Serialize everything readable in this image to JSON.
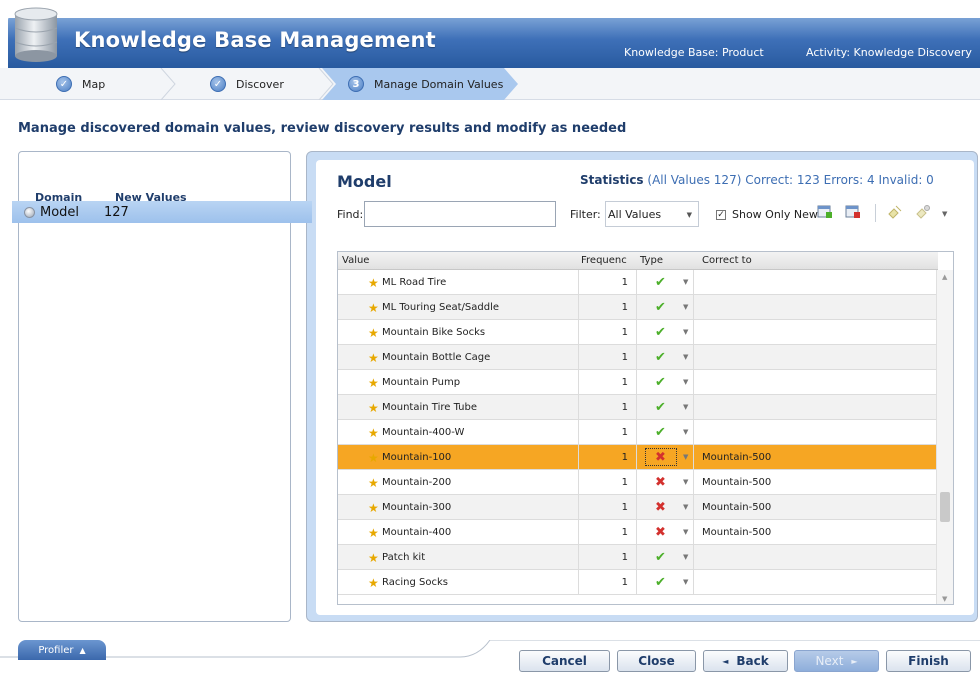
{
  "header": {
    "app_title": "Knowledge Base Management",
    "knowledge_base": "Knowledge Base: Product",
    "activity": "Activity: Knowledge Discovery"
  },
  "steps": [
    {
      "label": "Map",
      "badge": "✓"
    },
    {
      "label": "Discover",
      "badge": "✓"
    },
    {
      "label": "Manage Domain Values",
      "badge": "3"
    }
  ],
  "instruction": "Manage discovered domain values, review discovery results and modify as needed",
  "left_panel": {
    "col_domain": "Domain",
    "col_new_values": "New Values",
    "rows": [
      {
        "domain": "Model",
        "new_values": "127"
      }
    ]
  },
  "right_panel": {
    "title": "Model",
    "stats_label": "Statistics",
    "stats_all": "(All Values 127)",
    "stats_correct": "Correct: 123",
    "stats_errors": "Errors: 4",
    "stats_invalid": "Invalid: 0",
    "find_label": "Find:",
    "find_value": "",
    "filter_label": "Filter:",
    "filter_value": "All Values",
    "show_only_new": "Show Only New"
  },
  "grid": {
    "columns": {
      "value": "Value",
      "frequency": "Frequenc",
      "type": "Type",
      "correct_to": "Correct to"
    },
    "rows": [
      {
        "value": "ML Road Tire",
        "frequency": "1",
        "type": "correct",
        "correct_to": ""
      },
      {
        "value": "ML Touring Seat/Saddle",
        "frequency": "1",
        "type": "correct",
        "correct_to": ""
      },
      {
        "value": "Mountain Bike Socks",
        "frequency": "1",
        "type": "correct",
        "correct_to": ""
      },
      {
        "value": "Mountain Bottle Cage",
        "frequency": "1",
        "type": "correct",
        "correct_to": ""
      },
      {
        "value": "Mountain Pump",
        "frequency": "1",
        "type": "correct",
        "correct_to": ""
      },
      {
        "value": "Mountain Tire Tube",
        "frequency": "1",
        "type": "correct",
        "correct_to": ""
      },
      {
        "value": "Mountain-400-W",
        "frequency": "1",
        "type": "correct",
        "correct_to": ""
      },
      {
        "value": "Mountain-100",
        "frequency": "1",
        "type": "error",
        "correct_to": "Mountain-500",
        "selected": true
      },
      {
        "value": "Mountain-200",
        "frequency": "1",
        "type": "error",
        "correct_to": "Mountain-500"
      },
      {
        "value": "Mountain-300",
        "frequency": "1",
        "type": "error",
        "correct_to": "Mountain-500"
      },
      {
        "value": "Mountain-400",
        "frequency": "1",
        "type": "error",
        "correct_to": "Mountain-500"
      },
      {
        "value": "Patch kit",
        "frequency": "1",
        "type": "correct",
        "correct_to": ""
      },
      {
        "value": "Racing Socks",
        "frequency": "1",
        "type": "correct",
        "correct_to": ""
      }
    ]
  },
  "footer": {
    "profiler": "Profiler",
    "cancel": "Cancel",
    "close": "Close",
    "back": "Back",
    "next": "Next",
    "finish": "Finish"
  },
  "colors": {
    "brand": "#3e70b8",
    "selected_row": "#f6a623",
    "correct": "#4caf2a",
    "error": "#d3312e"
  }
}
